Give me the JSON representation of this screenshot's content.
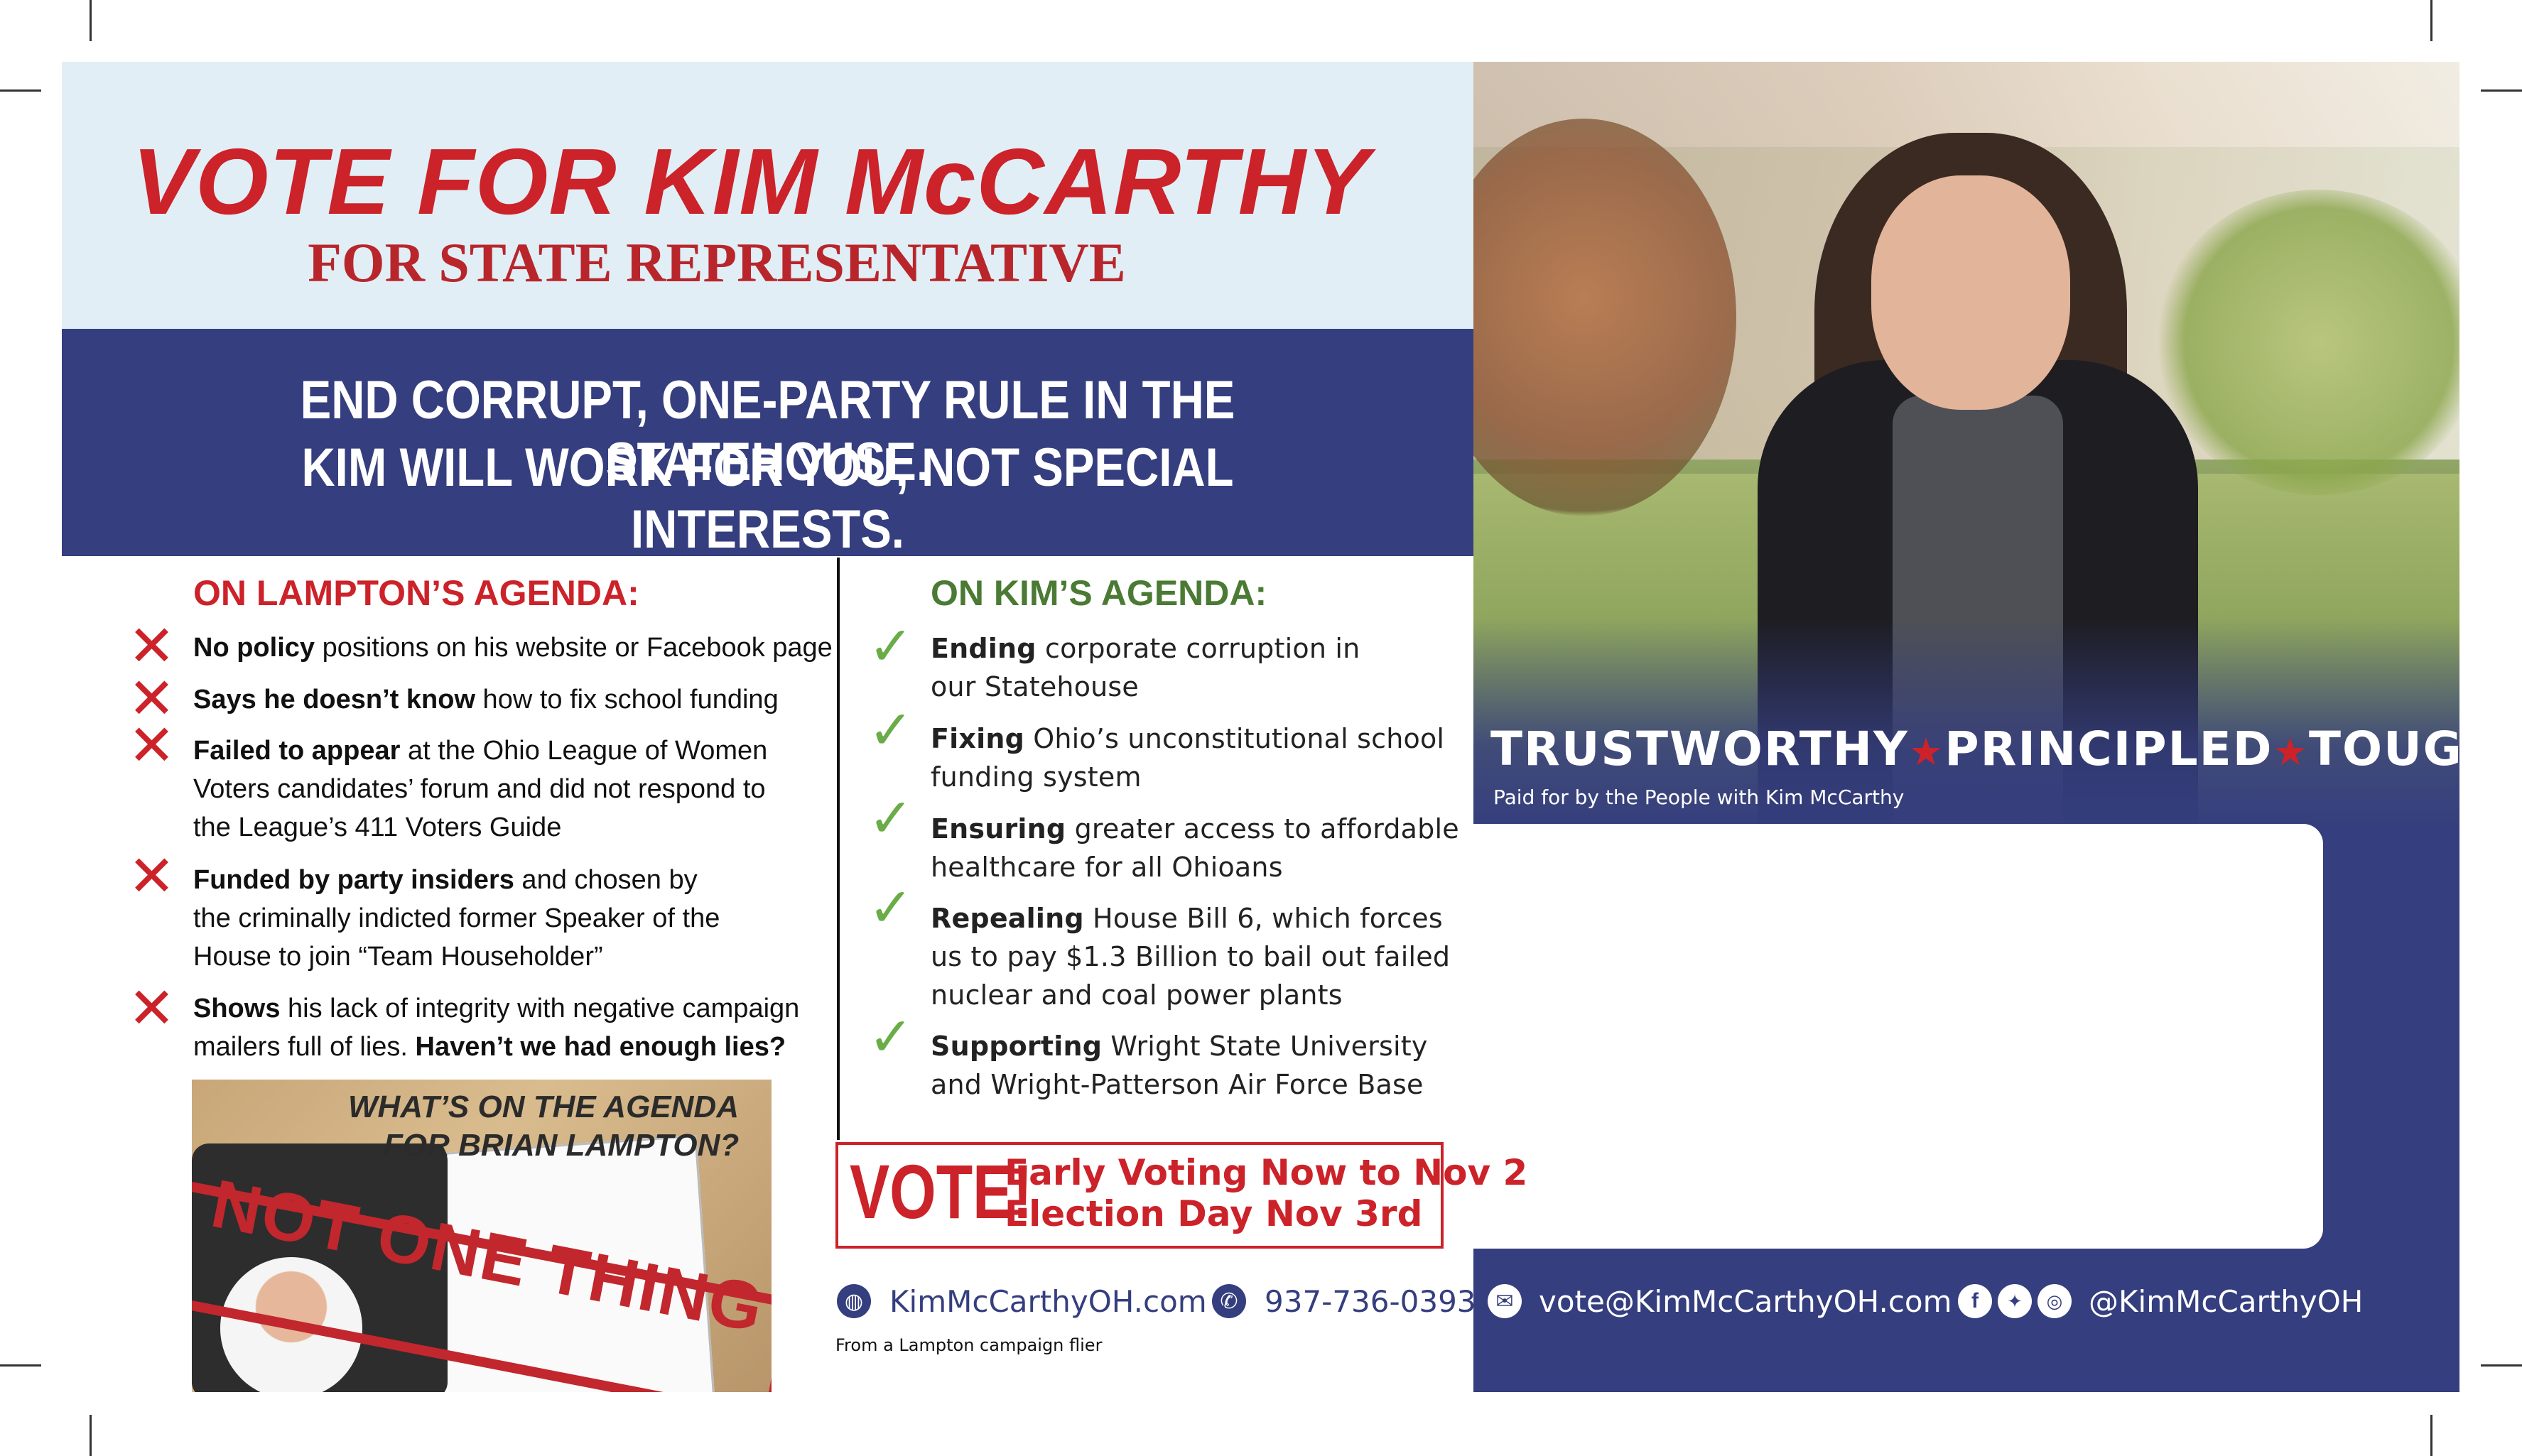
{
  "header": {
    "headline": "VOTE FOR KIM McCARTHY",
    "subhead": "FOR STATE REPRESENTATIVE"
  },
  "slogan": {
    "line1": "END CORRUPT, ONE-PARTY RULE IN THE STATEHOUSE.",
    "line2": "KIM WILL WORK FOR YOU, NOT SPECIAL INTERESTS."
  },
  "lampton": {
    "title": "ON LAMPTON’S AGENDA:",
    "items": [
      {
        "bold": "No policy",
        "rest": " positions on his website or Facebook page"
      },
      {
        "bold": "Says he doesn’t know",
        "rest": " how to fix school funding"
      },
      {
        "bold": "Failed to appear",
        "rest": " at the Ohio League of Women",
        "line2": "Voters candidates’ forum and did not respond to",
        "line3": "the League’s 411 Voters Guide"
      },
      {
        "bold": "Funded by party insiders",
        "rest": " and chosen by",
        "line2": "the criminally indicted former Speaker of the",
        "line3": "House to join “Team Householder”"
      },
      {
        "bold": "Shows",
        "rest": " his lack of integrity with negative campaign",
        "line2a": "mailers full of lies. ",
        "line2b": "Haven’t we had enough lies?"
      }
    ]
  },
  "kim": {
    "title": "ON KIM’S AGENDA:",
    "items": [
      {
        "bold": "Ending",
        "rest": " corporate corruption in",
        "line2": "our Statehouse"
      },
      {
        "bold": "Fixing",
        "rest": " Ohio’s unconstitutional school",
        "line2": "funding system"
      },
      {
        "bold": "Ensuring",
        "rest": " greater access to affordable",
        "line2": "healthcare for all Ohioans"
      },
      {
        "bold": "Repealing",
        "rest": " House Bill 6, which forces",
        "line2": "us to pay $1.3 Billion to bail out failed",
        "line3": "nuclear and coal power plants"
      },
      {
        "bold": "Supporting",
        "rest": " Wright State University",
        "line2": "and Wright-Patterson Air Force Base"
      }
    ]
  },
  "flier": {
    "title_line1": "WHAT’S ON THE AGENDA",
    "title_line2": "FOR BRIAN LAMPTON?",
    "stamp": "NOT ONE THING",
    "caption": "From a Lampton campaign flier"
  },
  "vote": {
    "word": "VOTE!",
    "line1": "Early Voting Now to Nov 2",
    "line2": "Election Day Nov 3rd"
  },
  "traits": {
    "t1": "TRUSTWORTHY",
    "t2": "PRINCIPLED",
    "t3": "TOUGH",
    "star": "★"
  },
  "paid_for": "Paid for by the People with Kim McCarthy",
  "contact": {
    "website": "KimMcCarthyOH.com",
    "phone": "937-736-0393",
    "email": "vote@KimMcCarthyOH.com",
    "social": "@KimMcCarthyOH"
  },
  "icons": {
    "x": "✕",
    "check": "✓"
  },
  "colors": {
    "red": "#cc2229",
    "navy": "#353e7e",
    "light_blue": "#e1eef5",
    "green": "#6aac47"
  }
}
